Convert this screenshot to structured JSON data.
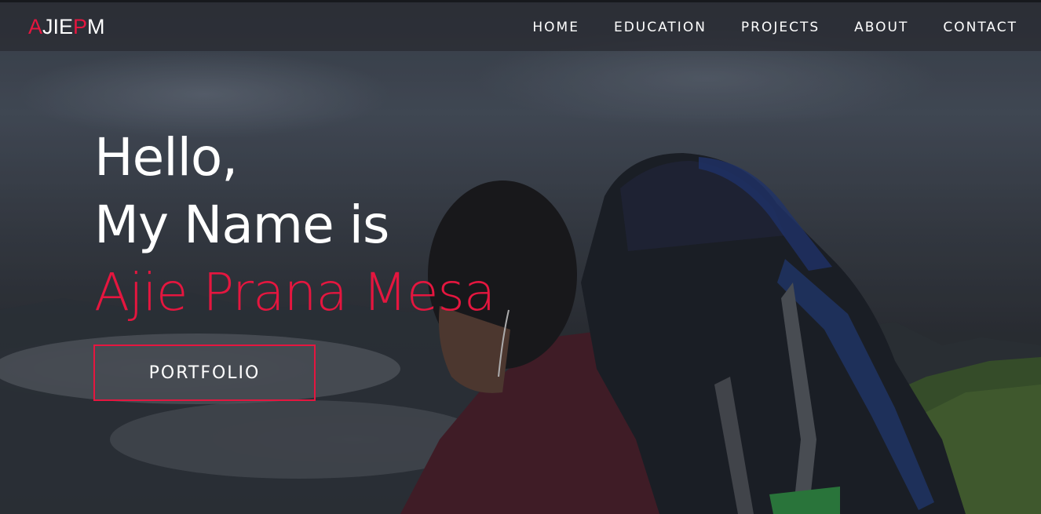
{
  "logo": {
    "letters": [
      {
        "char": "A",
        "accent": true
      },
      {
        "char": "JIE",
        "accent": false
      },
      {
        "char": "P",
        "accent": true
      },
      {
        "char": "M",
        "accent": false
      }
    ]
  },
  "nav": {
    "items": [
      "HOME",
      "EDUCATION",
      "PROJECTS",
      "ABOUT",
      "CONTACT"
    ]
  },
  "hero": {
    "line1": "Hello,",
    "line2": "My Name is",
    "name": "Ajie Prana Mesa",
    "button_label": "PORTFOLIO"
  },
  "colors": {
    "accent": "#e5163f",
    "text": "#ffffff",
    "navbar_bg": "#2a2c31"
  }
}
